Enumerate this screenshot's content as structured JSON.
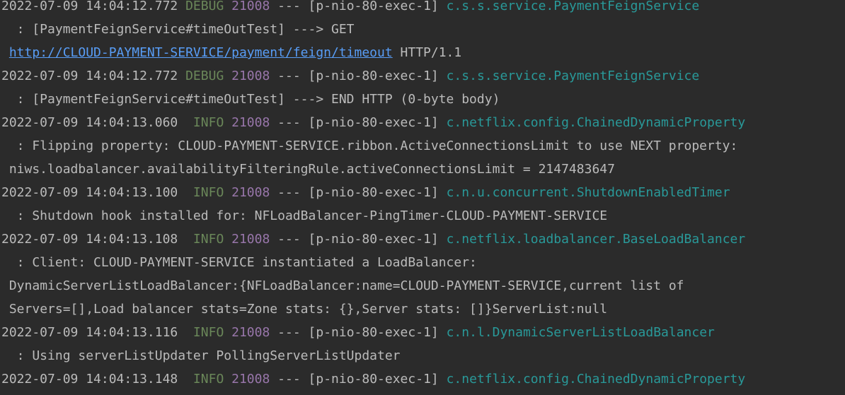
{
  "colors": {
    "background": "#2b2b2b",
    "text": "#bbbbbb",
    "level": "#6a8759",
    "pid": "#9876aa",
    "logger": "#299999",
    "link": "#589df6"
  },
  "entries": [
    {
      "timestamp": "2022-07-09 14:04:12.772",
      "level": "DEBUG",
      "pid": "21008",
      "sep": "---",
      "thread": "[p-nio-80-exec-1]",
      "logger": "c.s.s.service.PaymentFeignService",
      "msg1": "  : [PaymentFeignService#timeOutTest] ---> GET",
      "link": "http://CLOUD-PAYMENT-SERVICE/payment/feign/timeout",
      "link_suffix": " HTTP/1.1"
    },
    {
      "timestamp": "2022-07-09 14:04:12.772",
      "level": "DEBUG",
      "pid": "21008",
      "sep": "---",
      "thread": "[p-nio-80-exec-1]",
      "logger": "c.s.s.service.PaymentFeignService",
      "msg1": "  : [PaymentFeignService#timeOutTest] ---> END HTTP (0-byte body)"
    },
    {
      "timestamp": "2022-07-09 14:04:13.060",
      "level": " INFO",
      "pid": "21008",
      "sep": "---",
      "thread": "[p-nio-80-exec-1]",
      "logger": "c.netflix.config.ChainedDynamicProperty",
      "msg1": "  : Flipping property: CLOUD-PAYMENT-SERVICE.ribbon.ActiveConnectionsLimit to use NEXT property:",
      "msg2": " niws.loadbalancer.availabilityFilteringRule.activeConnectionsLimit = 2147483647"
    },
    {
      "timestamp": "2022-07-09 14:04:13.100",
      "level": " INFO",
      "pid": "21008",
      "sep": "---",
      "thread": "[p-nio-80-exec-1]",
      "logger": "c.n.u.concurrent.ShutdownEnabledTimer",
      "msg1": "  : Shutdown hook installed for: NFLoadBalancer-PingTimer-CLOUD-PAYMENT-SERVICE"
    },
    {
      "timestamp": "2022-07-09 14:04:13.108",
      "level": " INFO",
      "pid": "21008",
      "sep": "---",
      "thread": "[p-nio-80-exec-1]",
      "logger": "c.netflix.loadbalancer.BaseLoadBalancer",
      "msg1": "  : Client: CLOUD-PAYMENT-SERVICE instantiated a LoadBalancer:",
      "msg2": "DynamicServerListLoadBalancer:{NFLoadBalancer:name=CLOUD-PAYMENT-SERVICE,current list of",
      "msg3": "Servers=[],Load balancer stats=Zone stats: {},Server stats: []}ServerList:null"
    },
    {
      "timestamp": "2022-07-09 14:04:13.116",
      "level": " INFO",
      "pid": "21008",
      "sep": "---",
      "thread": "[p-nio-80-exec-1]",
      "logger": "c.n.l.DynamicServerListLoadBalancer",
      "msg1": "  : Using serverListUpdater PollingServerListUpdater"
    },
    {
      "timestamp": "2022-07-09 14:04:13.148",
      "level": " INFO",
      "pid": "21008",
      "sep": "---",
      "thread": "[p-nio-80-exec-1]",
      "logger": "c.netflix.config.ChainedDynamicProperty"
    }
  ]
}
